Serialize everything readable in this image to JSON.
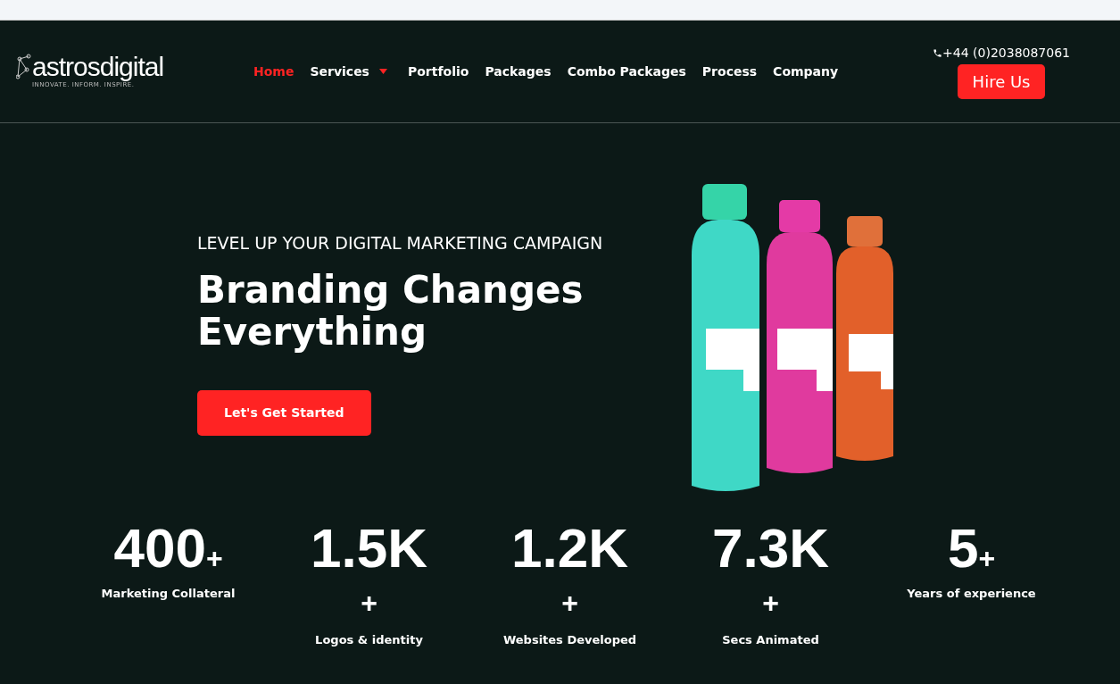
{
  "logo": {
    "word_a": "astros",
    "word_b": "digital",
    "tagline": "INNOVATE. INFORM. INSPIRE."
  },
  "nav": [
    {
      "label": "Home",
      "selected": true,
      "dropdown": false
    },
    {
      "label": "Services",
      "selected": false,
      "dropdown": true
    },
    {
      "label": "Portfolio",
      "selected": false,
      "dropdown": false
    },
    {
      "label": "Packages",
      "selected": false,
      "dropdown": false
    },
    {
      "label": "Combo Packages",
      "selected": false,
      "dropdown": false
    },
    {
      "label": "Process",
      "selected": false,
      "dropdown": false
    },
    {
      "label": "Company",
      "selected": false,
      "dropdown": false
    }
  ],
  "phone": "+44 (0)2038087061",
  "hire_button": "Hire Us",
  "hero": {
    "eyebrow": "LEVEL UP YOUR DIGITAL MARKETING CAMPAIGN",
    "title": "Branding Changes Everything",
    "button": "Let's Get Started"
  },
  "stats": [
    {
      "value": "400",
      "plus": "+",
      "label": "Marketing Collateral",
      "kind": "inline"
    },
    {
      "value": "1.5K",
      "plus": "+",
      "label": "Logos & identity",
      "kind": "stacked"
    },
    {
      "value": "1.2K",
      "plus": "+",
      "label": "Websites Developed",
      "kind": "stacked"
    },
    {
      "value": "7.3K",
      "plus": "+",
      "label": "Secs Animated",
      "kind": "stacked"
    },
    {
      "value": "5",
      "plus": "+",
      "label": "Years of experience",
      "kind": "inline"
    }
  ]
}
